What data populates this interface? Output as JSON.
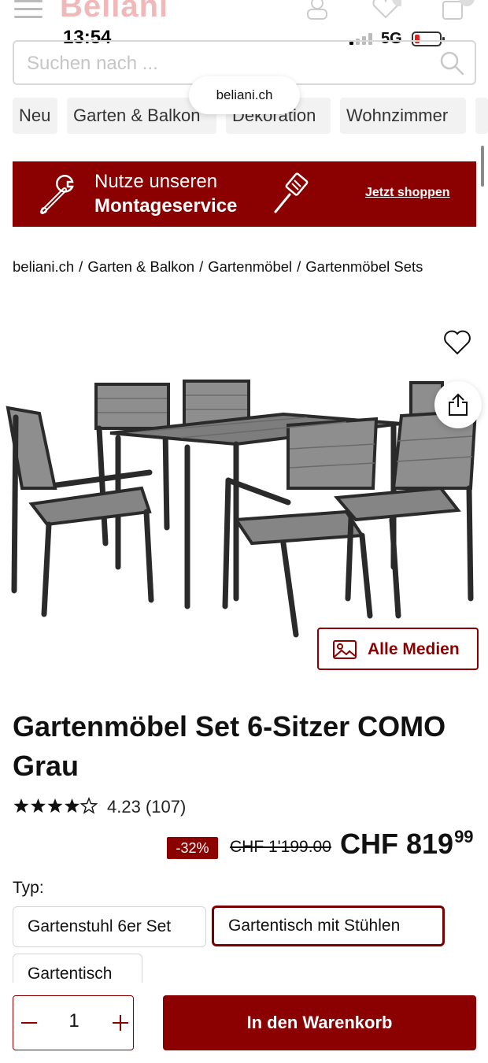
{
  "header": {
    "logo_text": "Beliani",
    "icons": [
      "menu-icon",
      "user-icon",
      "heart-icon",
      "bag-icon"
    ]
  },
  "status_bar": {
    "time": "13:54",
    "network": "5G"
  },
  "search": {
    "placeholder": "Suchen nach ...",
    "value": ""
  },
  "browser": {
    "url": "beliani.ch"
  },
  "categories": [
    "Neu",
    "Garten & Balkon",
    "Dekoration",
    "Wohnzimmer"
  ],
  "banner": {
    "line1": "Nutze unseren",
    "line2": "Montageservice",
    "cta": "Jetzt shoppen",
    "background": "#8b0000"
  },
  "breadcrumb": [
    "beliani.ch",
    "Garten & Balkon",
    "Gartenmöbel",
    "Gartenmöbel Sets"
  ],
  "breadcrumb_separator": "/",
  "gallery": {
    "media_button": "Alle Medien"
  },
  "product": {
    "title": "Gartenmöbel Set 6-Sitzer COMO Grau",
    "rating": 4.23,
    "rating_text": "4.23 (107)",
    "stars_filled": 4,
    "stars_total": 5,
    "discount": "-32%",
    "old_price": "CHF 1'199.00",
    "price_main": "CHF 819",
    "price_cents": "99"
  },
  "variant": {
    "label": "Typ:",
    "options": [
      "Gartenstuhl 6er Set",
      "Gartentisch mit Stühlen",
      "Gartentisch"
    ],
    "selected": "Gartentisch mit Stühlen"
  },
  "cart": {
    "quantity": "1",
    "button": "In den Warenkorb"
  },
  "colors": {
    "brand": "#8b0000",
    "text": "#111111"
  }
}
